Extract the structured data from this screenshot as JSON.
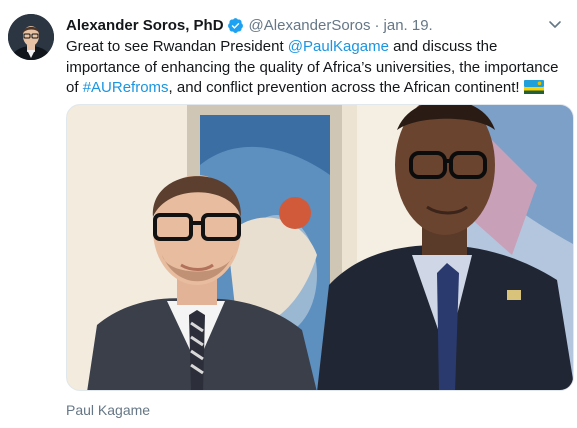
{
  "tweet": {
    "author_name": "Alexander Soros, PhD",
    "handle": "@AlexanderSoros",
    "separator": "·",
    "timestamp": "jan. 19.",
    "text_parts": {
      "p1": "Great to see Rwandan President ",
      "mention": "@PaulKagame",
      "p2": " and discuss the importance of enhancing the quality of Africa’s universities, the importance of ",
      "hashtag": "#AURefroms",
      "p3": ", and conflict prevention across the African continent!"
    },
    "media_caption": "Paul Kagame"
  },
  "colors": {
    "link": "#1b95e0",
    "verified": "#1da1f2",
    "secondary_text": "#657786"
  },
  "icons": {
    "verified": "verified-badge-icon",
    "menu": "chevron-down-icon",
    "flag": "rwanda-flag-emoji"
  }
}
